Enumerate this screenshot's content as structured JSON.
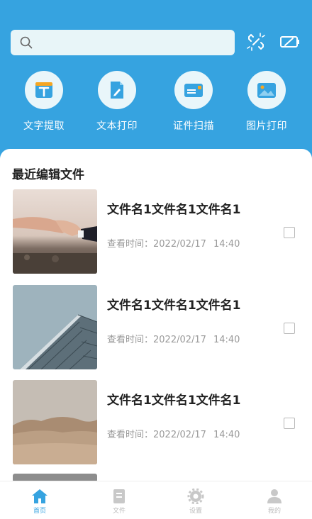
{
  "search": {
    "placeholder": "",
    "value": ""
  },
  "top_icons": [
    "link-scan-icon",
    "battery-icon"
  ],
  "tools": [
    {
      "label": "文字提取",
      "icon": "text-extract-icon"
    },
    {
      "label": "文本打印",
      "icon": "doc-print-icon"
    },
    {
      "label": "证件扫描",
      "icon": "id-scan-icon"
    },
    {
      "label": "图片打印",
      "icon": "image-print-icon"
    }
  ],
  "recent": {
    "title": "最近编辑文件",
    "files": [
      {
        "name": "文件名1文件名1文件名1",
        "time_label": "查看时间：",
        "date": "2022/02/17",
        "time": "14:40",
        "thumb": "hands-photo"
      },
      {
        "name": "文件名1文件名1文件名1",
        "time_label": "查看时间：",
        "date": "2022/02/17",
        "time": "14:40",
        "thumb": "building-photo"
      },
      {
        "name": "文件名1文件名1文件名1",
        "time_label": "查看时间：",
        "date": "2022/02/17",
        "time": "14:40",
        "thumb": "desert-photo"
      }
    ]
  },
  "nav": [
    {
      "label": "首页",
      "icon": "home-icon",
      "active": true
    },
    {
      "label": "文件",
      "icon": "file-icon",
      "active": false
    },
    {
      "label": "设置",
      "icon": "settings-icon",
      "active": false
    },
    {
      "label": "我的",
      "icon": "profile-icon",
      "active": false
    }
  ],
  "colors": {
    "primary": "#36a3e0",
    "icon_bg": "#e9f6fa",
    "search_bg": "#e8f5f8"
  }
}
